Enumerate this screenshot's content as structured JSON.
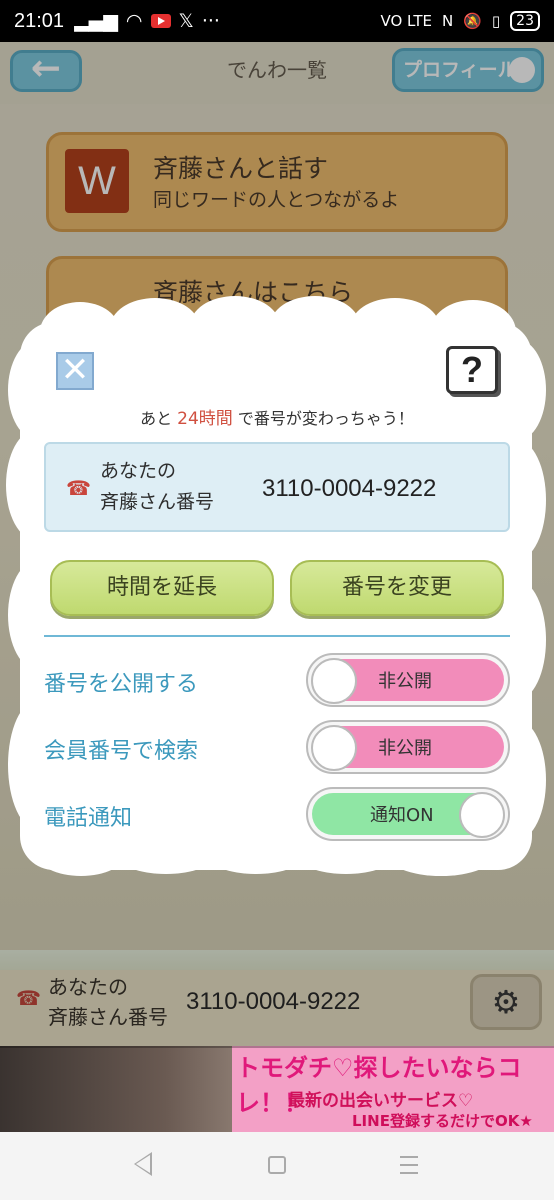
{
  "status_bar": {
    "time": "21:01",
    "right_text": "VO LTE",
    "battery": "23"
  },
  "header": {
    "back_icon": "←",
    "title": "でんわ一覧",
    "profile_label": "プロフィール"
  },
  "cards": [
    {
      "icon_letter": "W",
      "title": "斉藤さんと話す",
      "subtitle": "同じワードの人とつながるよ"
    },
    {
      "title": "斉藤さんはこちら"
    }
  ],
  "dialog": {
    "close_icon": "✕",
    "help_icon": "?",
    "notice_prefix": "あと",
    "notice_highlight": "24時間",
    "notice_suffix": "で番号が変わっちゃう！",
    "number_label_line1": "あなたの",
    "number_label_line2": "斉藤さん番号",
    "number": "3110-0004-9222",
    "extend_label": "時間を延長",
    "change_label": "番号を変更",
    "settings": [
      {
        "label": "番号を公開する",
        "state": "非公開",
        "on": false
      },
      {
        "label": "会員番号で検索",
        "state": "非公開",
        "on": false
      },
      {
        "label": "電話通知",
        "state": "通知ON",
        "on": true
      }
    ]
  },
  "bottom_bar": {
    "label_line1": "あなたの",
    "label_line2": "斉藤さん番号",
    "number": "3110-0004-9222",
    "gear_icon": "⚙"
  },
  "ad": {
    "line1": "トモダチ♡探したいならコレ！！",
    "line2": "最新の出会いサービス♡",
    "line3": "LINE登録するだけでOK★"
  },
  "colors": {
    "accent_blue": "#3c99bd",
    "toggle_off": "#f28cba",
    "toggle_on": "#8fe6a4",
    "button_green": "#c9df80",
    "highlight_red": "#d05040"
  }
}
